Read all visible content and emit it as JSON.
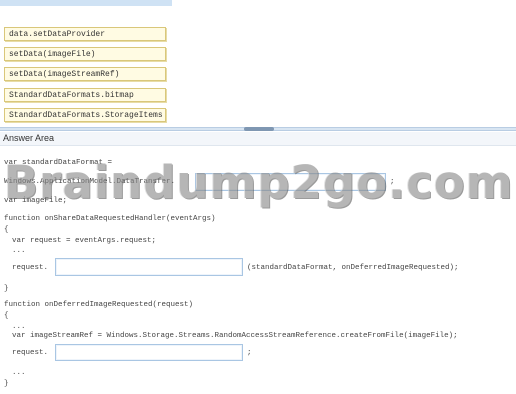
{
  "options": [
    "data.setDataProvider",
    "setData(imageFile)",
    "setData(imageStreamRef)",
    "StandardDataFormats.bitmap",
    "StandardDataFormats.StorageItems"
  ],
  "answer_area": {
    "title": "Answer Area"
  },
  "code": {
    "line1": "var standardDataFormat =",
    "line2": "Windows.ApplicationModel.DataTransfer.",
    "line2_end": ";",
    "line3": "var imageFile;",
    "line4": "function onShareDataRequestedHandler(eventArgs)",
    "line5": "{",
    "line6": "var request = eventArgs.request;",
    "line7": "...",
    "line8_prefix": "request.",
    "line8_suffix": "(standardDataFormat, onDeferredImageRequested);",
    "line9": "}",
    "line10": "function onDeferredImageRequested(request)",
    "line11": "{",
    "line12": "...",
    "line13": "var imageStreamRef = Windows.Storage.Streams.RandomAccessStreamReference.createFromFile(imageFile);",
    "line14_prefix": "request.",
    "line14_suffix": ";",
    "line15": "...",
    "line16": "}"
  },
  "watermark": {
    "text": "Braindump2go.com"
  }
}
